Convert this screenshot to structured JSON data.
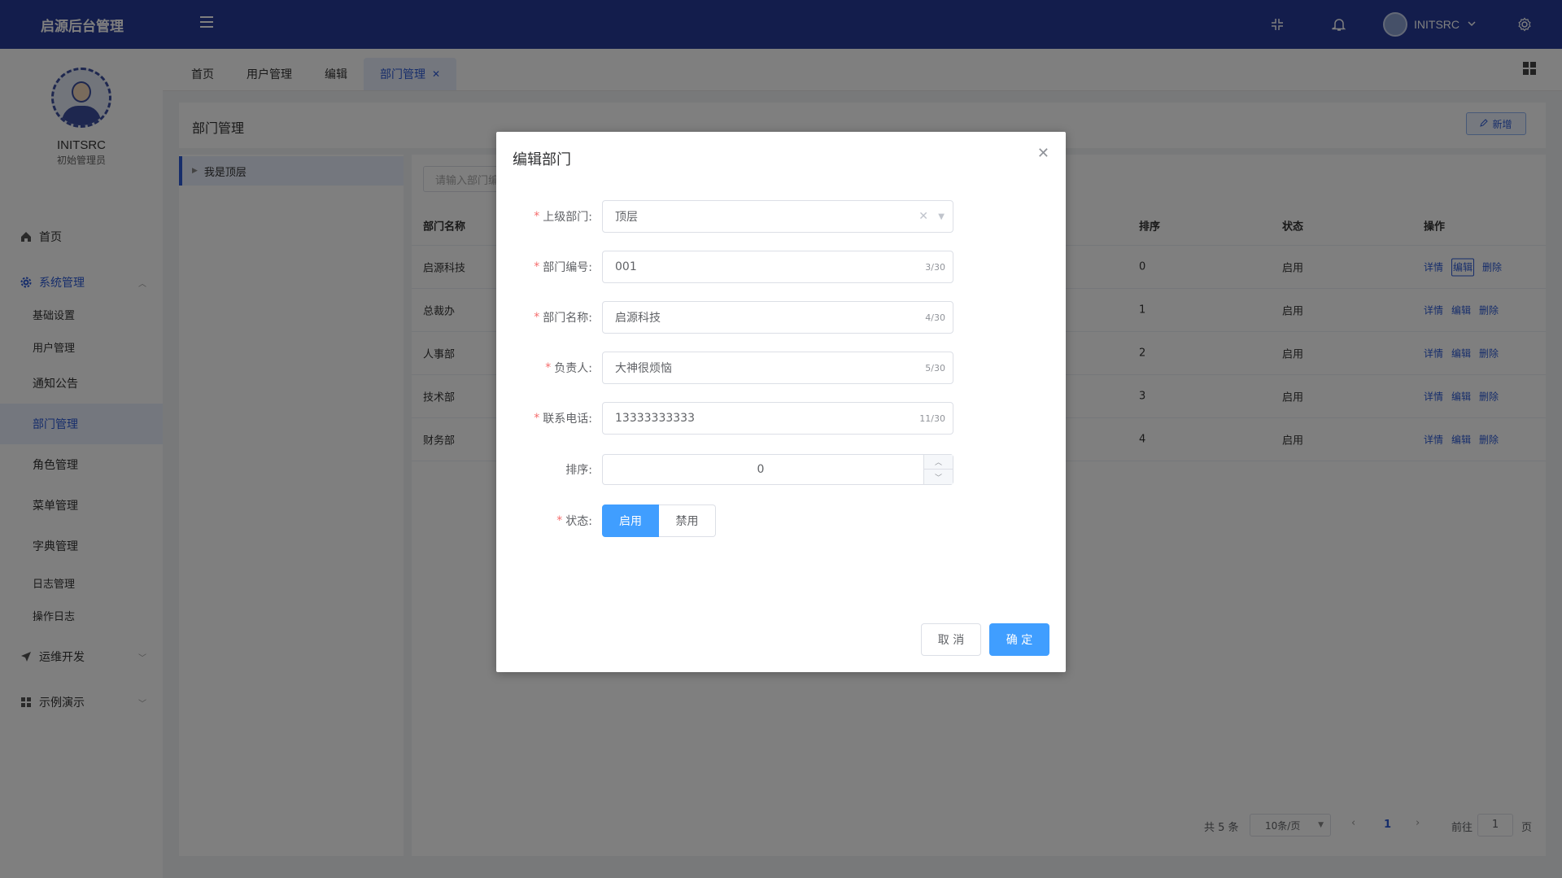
{
  "header": {
    "brand": "启源后台管理",
    "username": "INITSRC"
  },
  "sidebar": {
    "name": "INITSRC",
    "role": "初始管理员",
    "menu": {
      "home": "首页",
      "system": "系统管理",
      "system_items": [
        "基础设置",
        "用户管理",
        "通知公告",
        "部门管理",
        "角色管理",
        "菜单管理",
        "字典管理",
        "日志管理",
        "操作日志"
      ],
      "ops": "运维开发",
      "demo": "示例演示"
    }
  },
  "tabs": [
    "首页",
    "用户管理",
    "编辑",
    "部门管理"
  ],
  "page": {
    "title": "部门管理",
    "add_label": "新增",
    "tree_root": "我是顶层",
    "search_placeholder": "请输入部门编"
  },
  "table": {
    "headers": {
      "name": "部门名称",
      "sort": "排序",
      "status": "状态",
      "ops": "操作"
    },
    "rows": [
      {
        "name": "启源科技",
        "sort": "0",
        "status": "启用"
      },
      {
        "name": "总裁办",
        "sort": "1",
        "status": "启用"
      },
      {
        "name": "人事部",
        "sort": "2",
        "status": "启用"
      },
      {
        "name": "技术部",
        "sort": "3",
        "status": "启用"
      },
      {
        "name": "财务部",
        "sort": "4",
        "status": "启用"
      }
    ],
    "ops": {
      "detail": "详情",
      "edit": "编辑",
      "delete": "删除"
    }
  },
  "pager": {
    "total": "共 5 条",
    "page_size": "10条/页",
    "current": "1",
    "goto": "前往",
    "goto_value": "1",
    "unit": "页"
  },
  "dialog": {
    "title": "编辑部门",
    "fields": {
      "parent": {
        "label": "上级部门:",
        "value": "顶层"
      },
      "code": {
        "label": "部门编号:",
        "value": "001",
        "count": "3/30"
      },
      "name": {
        "label": "部门名称:",
        "value": "启源科技",
        "count": "4/30"
      },
      "leader": {
        "label": "负责人:",
        "value": "大神很烦恼",
        "count": "5/30"
      },
      "phone": {
        "label": "联系电话:",
        "value": "13333333333",
        "count": "11/30"
      },
      "sort": {
        "label": "排序:",
        "value": "0"
      },
      "status": {
        "label": "状态:",
        "on": "启用",
        "off": "禁用",
        "selected": "启用"
      }
    },
    "cancel": "取 消",
    "confirm": "确 定"
  },
  "colors": {
    "header": "#263a99",
    "primary": "#409eff",
    "accent": "#2d5bd6",
    "required": "#f56c6c"
  }
}
